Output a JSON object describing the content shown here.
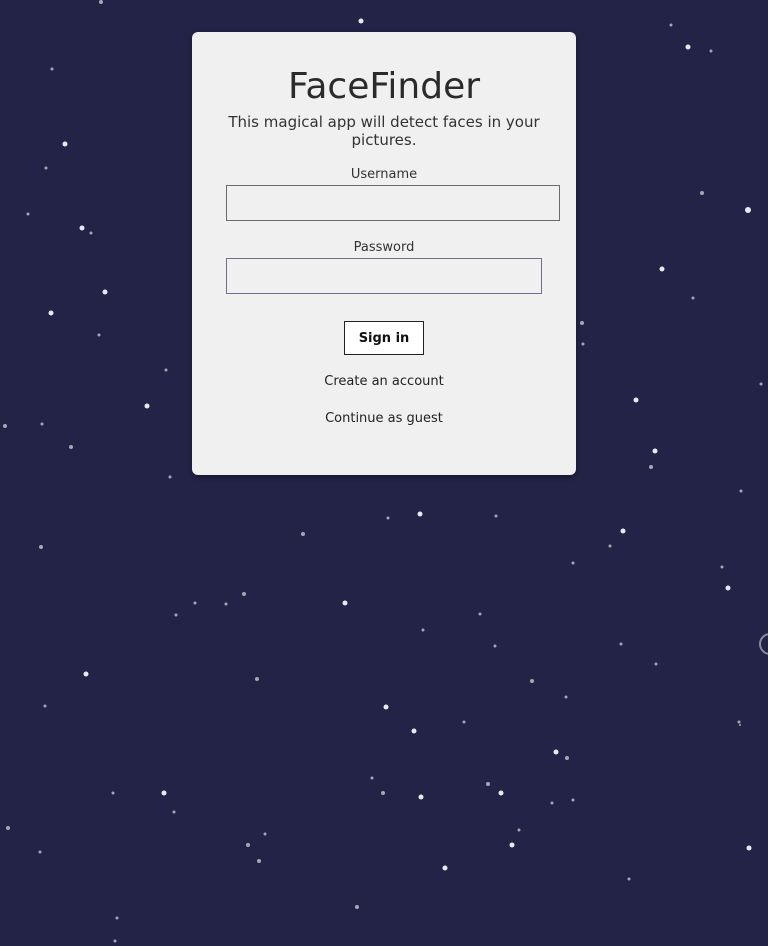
{
  "app": {
    "title": "FaceFinder",
    "subtitle": "This magical app will detect faces in your pictures."
  },
  "form": {
    "username_label": "Username",
    "username_value": "",
    "password_label": "Password",
    "password_value": "",
    "signin_label": "Sign in"
  },
  "links": {
    "create_account": "Create an account",
    "continue_guest": "Continue as guest"
  },
  "theme": {
    "background": "#222346",
    "card_background": "#f0f0f0",
    "star_color": "#ffffff"
  }
}
